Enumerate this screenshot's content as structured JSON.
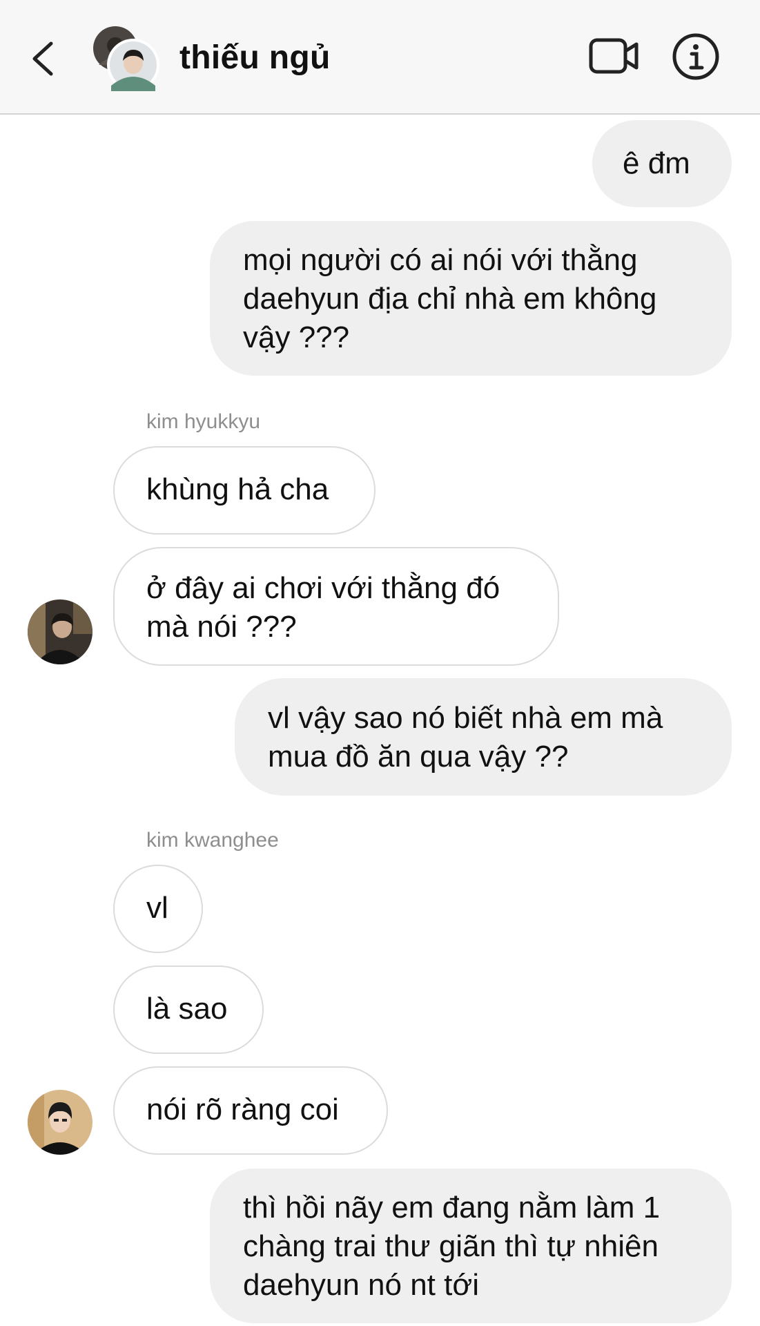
{
  "header": {
    "back_icon": "chevron-left-icon",
    "group_avatar_icon": "group-avatar",
    "title": "thiếu ngủ",
    "video_icon": "video-camera-icon",
    "info_icon": "info-icon"
  },
  "colors": {
    "header_bg": "#f7f7f7",
    "outgoing_bubble": "#efefef",
    "incoming_bubble_border": "#dbdbdb",
    "sender_name": "#8e8e8e"
  },
  "messages": [
    {
      "direction": "outgoing",
      "text": "ê đm"
    },
    {
      "direction": "outgoing",
      "text": "mọi người có ai nói với thằng\ndaehyun địa chỉ nhà em không\nvậy ???"
    },
    {
      "direction": "incoming",
      "sender": "kim hyukkyu",
      "text": "khùng hả cha"
    },
    {
      "direction": "incoming",
      "sender": "kim hyukkyu",
      "text": "ở đây ai chơi với thằng đó\nmà nói ???",
      "avatar": "hyukkyu-avatar"
    },
    {
      "direction": "outgoing",
      "text": "vl vậy sao nó biết nhà em mà\nmua đồ ăn qua vậy ??"
    },
    {
      "direction": "incoming",
      "sender": "kim kwanghee",
      "text": "vl"
    },
    {
      "direction": "incoming",
      "sender": "kim kwanghee",
      "text": "là sao"
    },
    {
      "direction": "incoming",
      "sender": "kim kwanghee",
      "text": "nói rõ ràng coi",
      "avatar": "kwanghee-avatar"
    },
    {
      "direction": "outgoing",
      "text": "thì hồi nãy em đang nằm làm 1\nchàng trai thư giãn thì tự nhiên\ndaehyun nó nt tới"
    }
  ],
  "sender_labels": {
    "hyukkyu": "kim hyukkyu",
    "kwanghee": "kim kwanghee"
  }
}
